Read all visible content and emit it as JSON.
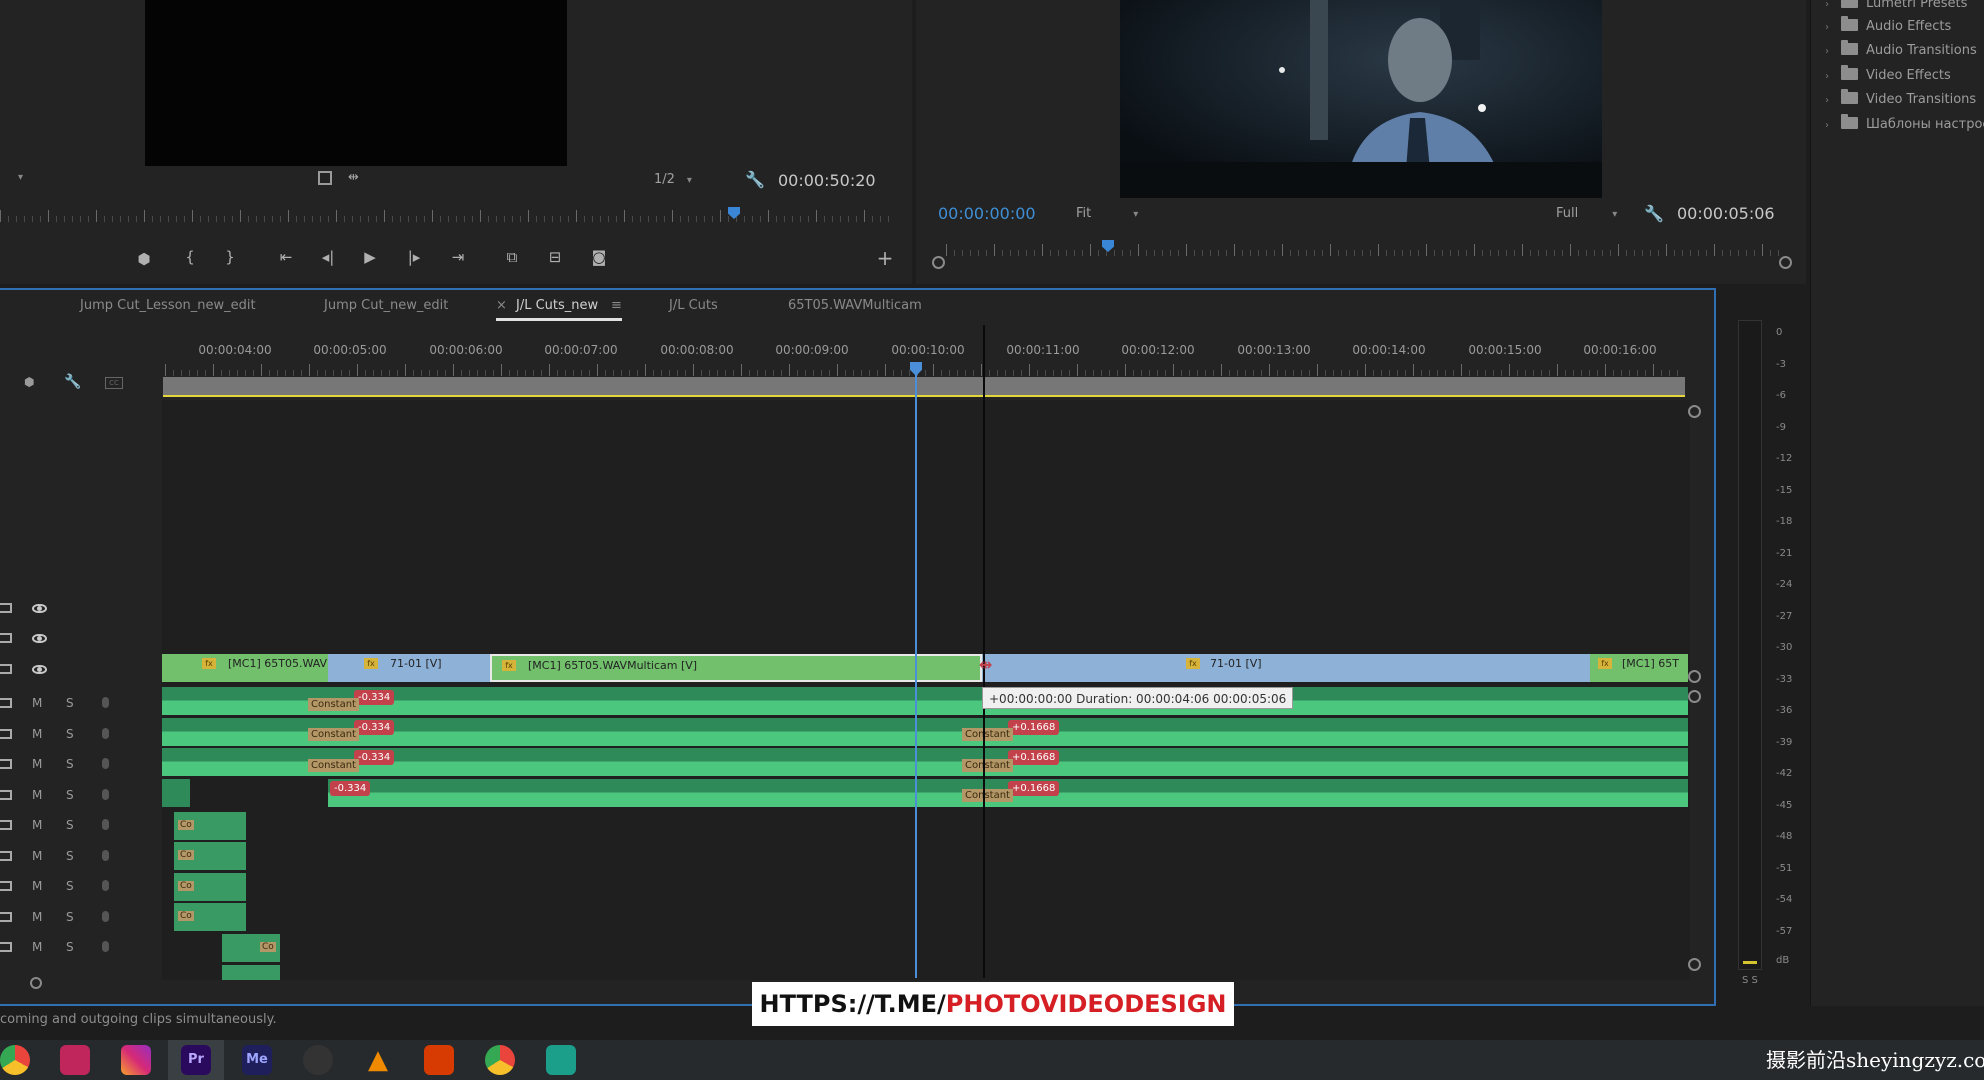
{
  "source_monitor": {
    "scale": "1/2",
    "timecode": "00:00:50:20"
  },
  "program_monitor": {
    "timecode_current": "00:00:00:00",
    "zoom": "Fit",
    "quality": "Full",
    "timecode_duration": "00:00:05:06"
  },
  "effects_panel": {
    "items": [
      "Lumetri Presets",
      "Audio Effects",
      "Audio Transitions",
      "Video Effects",
      "Video Transitions",
      "Шаблоны настроек"
    ]
  },
  "timeline": {
    "tabs": [
      {
        "label": "Jump Cut_Lesson_new_edit"
      },
      {
        "label": "Jump Cut_new_edit"
      },
      {
        "label": "J/L Cuts_new",
        "close": "×",
        "menu": "≡"
      },
      {
        "label": "J/L Cuts"
      },
      {
        "label": "65T05.WAVMulticam"
      }
    ],
    "time_labels": [
      "00:00:04:00",
      "00:00:05:00",
      "00:00:06:00",
      "00:00:07:00",
      "00:00:08:00",
      "00:00:09:00",
      "00:00:10:00",
      "00:00:11:00",
      "00:00:12:00",
      "00:00:13:00",
      "00:00:14:00",
      "00:00:15:00",
      "00:00:16:00"
    ],
    "audio_track_letters": {
      "mute": "M",
      "solo": "S"
    },
    "video_clips": [
      {
        "label": "[MC1] 65T05.WAV",
        "fx": "fx"
      },
      {
        "label": "71-01 [V]",
        "fx": "fx"
      },
      {
        "label": "[MC1] 65T05.WAVMulticam [V]",
        "fx": "fx"
      },
      {
        "label": "71-01 [V]",
        "fx": "fx"
      },
      {
        "label": "[MC1] 65T",
        "fx": "fx"
      }
    ],
    "badges": {
      "speed_a": "-0.334",
      "speed_b": "+0.1668",
      "constant": "Constant",
      "co": "Co"
    },
    "tooltip": "+00:00:00:00 Duration: 00:00:04:06 00:00:05:06",
    "meter_labels": [
      "0",
      "-3",
      "-6",
      "-9",
      "-12",
      "-15",
      "-18",
      "-21",
      "-24",
      "-27",
      "-30",
      "-33",
      "-36",
      "-39",
      "-42",
      "-45",
      "-48",
      "-51",
      "-54",
      "-57",
      "dB"
    ],
    "meter_bottom": "S S"
  },
  "status_bar": {
    "text": "coming and outgoing clips simultaneously."
  },
  "watermark": {
    "prefix": "HTTPS://T.ME/",
    "highlight": "PHOTOVIDEODESIGN"
  },
  "taskbar": {
    "apps": [
      {
        "icon": "chrome-icon",
        "text": ""
      },
      {
        "icon": "onenote-icon",
        "text": ""
      },
      {
        "icon": "instagram-icon",
        "text": ""
      },
      {
        "icon": "premiere-icon",
        "text": "Pr",
        "color": "#2a0a5c",
        "fg": "#b8a6ff"
      },
      {
        "icon": "media-encoder-icon",
        "text": "Me",
        "color": "#1f1f5c",
        "fg": "#9fa5ff"
      },
      {
        "icon": "davinci-icon",
        "text": ""
      },
      {
        "icon": "vlc-icon",
        "text": ""
      },
      {
        "icon": "office-icon",
        "text": ""
      },
      {
        "icon": "chrome-alt-icon",
        "text": ""
      },
      {
        "icon": "screen-recorder-icon",
        "text": ""
      }
    ],
    "corner_mark": "摄影前沿sheyingzyz.com"
  }
}
